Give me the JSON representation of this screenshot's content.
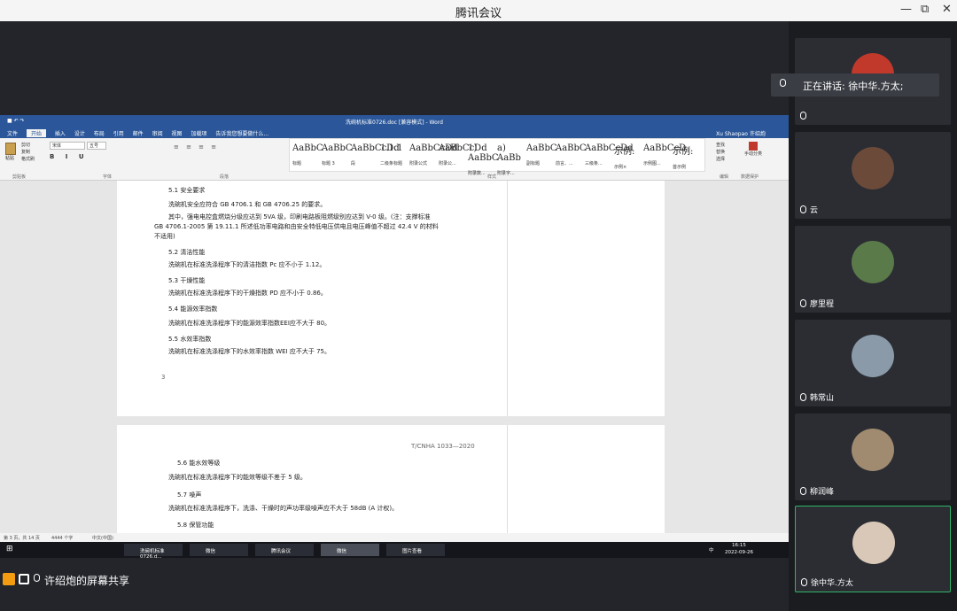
{
  "app_title": "腾讯会议",
  "window_controls": [
    "—",
    "⧉",
    "✕"
  ],
  "word": {
    "title": "洗碗机标准0726.doc [兼容模式] - Word",
    "user": "Xu Shaopao 许绍炮",
    "tabs": [
      "文件",
      "开始",
      "插入",
      "设计",
      "布局",
      "引用",
      "邮件",
      "审阅",
      "视图",
      "加载项"
    ],
    "tell_me": "告诉我您想要做什么...",
    "font_name": "宋体",
    "font_size": "五号",
    "paste_label": "粘贴",
    "clipboard_items": [
      "剪切",
      "复制",
      "格式刷"
    ],
    "groups": [
      "剪贴板",
      "字体",
      "段落",
      "样式",
      "编辑",
      "数据保护"
    ],
    "styles": [
      {
        "sample": "AaBbC",
        "name": "标题"
      },
      {
        "sample": "AaBbC",
        "name": "标题 3"
      },
      {
        "sample": "AaBbCcDd",
        "name": "段"
      },
      {
        "sample": "1.1.1",
        "name": "二级条标题"
      },
      {
        "sample": "AaBbCcDd",
        "name": "附录公式"
      },
      {
        "sample": "AaBbCcDd",
        "name": "附录公..."
      },
      {
        "sample": "1) AaBbC",
        "name": "附录数..."
      },
      {
        "sample": "a) AaBb",
        "name": "附录字..."
      },
      {
        "sample": "AaBbC",
        "name": "副标题"
      },
      {
        "sample": "AaBbC",
        "name": "前言、..."
      },
      {
        "sample": "AaBbCcDd",
        "name": "三级条..."
      },
      {
        "sample": "示例:",
        "name": "示例×"
      },
      {
        "sample": "AaBbCcD",
        "name": "示例图..."
      },
      {
        "sample": "示例:",
        "name": "首示例"
      }
    ],
    "edit_items": [
      "查找",
      "替换",
      "选择"
    ],
    "protect_label": "手动分类",
    "page1": [
      {
        "t": "5.1  安全要求",
        "h": true
      },
      {
        "t": "洗碗机安全应符合 GB 4706.1 和 GB 4706.25 的要求。"
      },
      {
        "t": "其中，强电电控盒燃烧分级应达到 5VA 级，印刷电路板阻燃级别应达到 V-0 级。(注：支撑标准"
      },
      {
        "t": "GB 4706.1-2005 第 19.11.1 所述低功率电路和由安全特低电压供电且电压峰值不超过 42.4 V 的材料"
      },
      {
        "t": "不适用)"
      },
      {
        "t": "5.2  清洁性能",
        "h": true
      },
      {
        "t": "洗碗机在标准洗涤程序下的清洁指数 Pc 应不小于 1.12。"
      },
      {
        "t": "5.3  干燥性能",
        "h": true
      },
      {
        "t": "洗碗机在标准洗涤程序下的干燥指数 PD 应不小于 0.86。"
      },
      {
        "t": "5.4  能源效率指数",
        "h": true
      },
      {
        "t": "洗碗机在标准洗涤程序下的能源效率指数EEI应不大于 80。"
      },
      {
        "t": "5.5  水效率指数",
        "h": true
      },
      {
        "t": "洗碗机在标准洗涤程序下的水效率指数 WEI 应不大于 75。"
      }
    ],
    "page_number": "3",
    "page2_header": "T/CNHA 1033—2020",
    "page2": [
      {
        "t": "5.6  能水效等级",
        "h": true
      },
      {
        "t": "洗碗机在标准洗涤程序下的能效等级不差于 5 级。"
      },
      {
        "t": "5.7  噪声",
        "h": true
      },
      {
        "t": "洗碗机在标准洗涤程序下，洗涤、干燥时的声功率级噪声应不大于 58dB (A 计权)。"
      },
      {
        "t": "5.8  保管功能",
        "h": true
      }
    ],
    "status": {
      "page": "第 3 页，共 14 页",
      "words": "4444 个字",
      "lang": "中文(中国)"
    }
  },
  "taskbar": {
    "items": [
      "洗碗机标准0726.d...",
      "微信",
      "腾讯会议",
      "微信",
      "图片查看"
    ],
    "time": "16:15",
    "date": "2022-09-26",
    "ime": "中"
  },
  "share_label": "许绍炮的屏幕共享",
  "speaking": "正在讲话: 徐中华.方太;",
  "participants": [
    {
      "name": "",
      "color": "#c0392b"
    },
    {
      "name": "云",
      "color": "#6b4a3a"
    },
    {
      "name": "廖里程",
      "color": "#5a7a4a"
    },
    {
      "name": "韩常山",
      "color": "#8a9aa8"
    },
    {
      "name": "柳润峰",
      "color": "#a08a70"
    },
    {
      "name": "徐中华.方太",
      "color": "#d9c8b8"
    }
  ]
}
